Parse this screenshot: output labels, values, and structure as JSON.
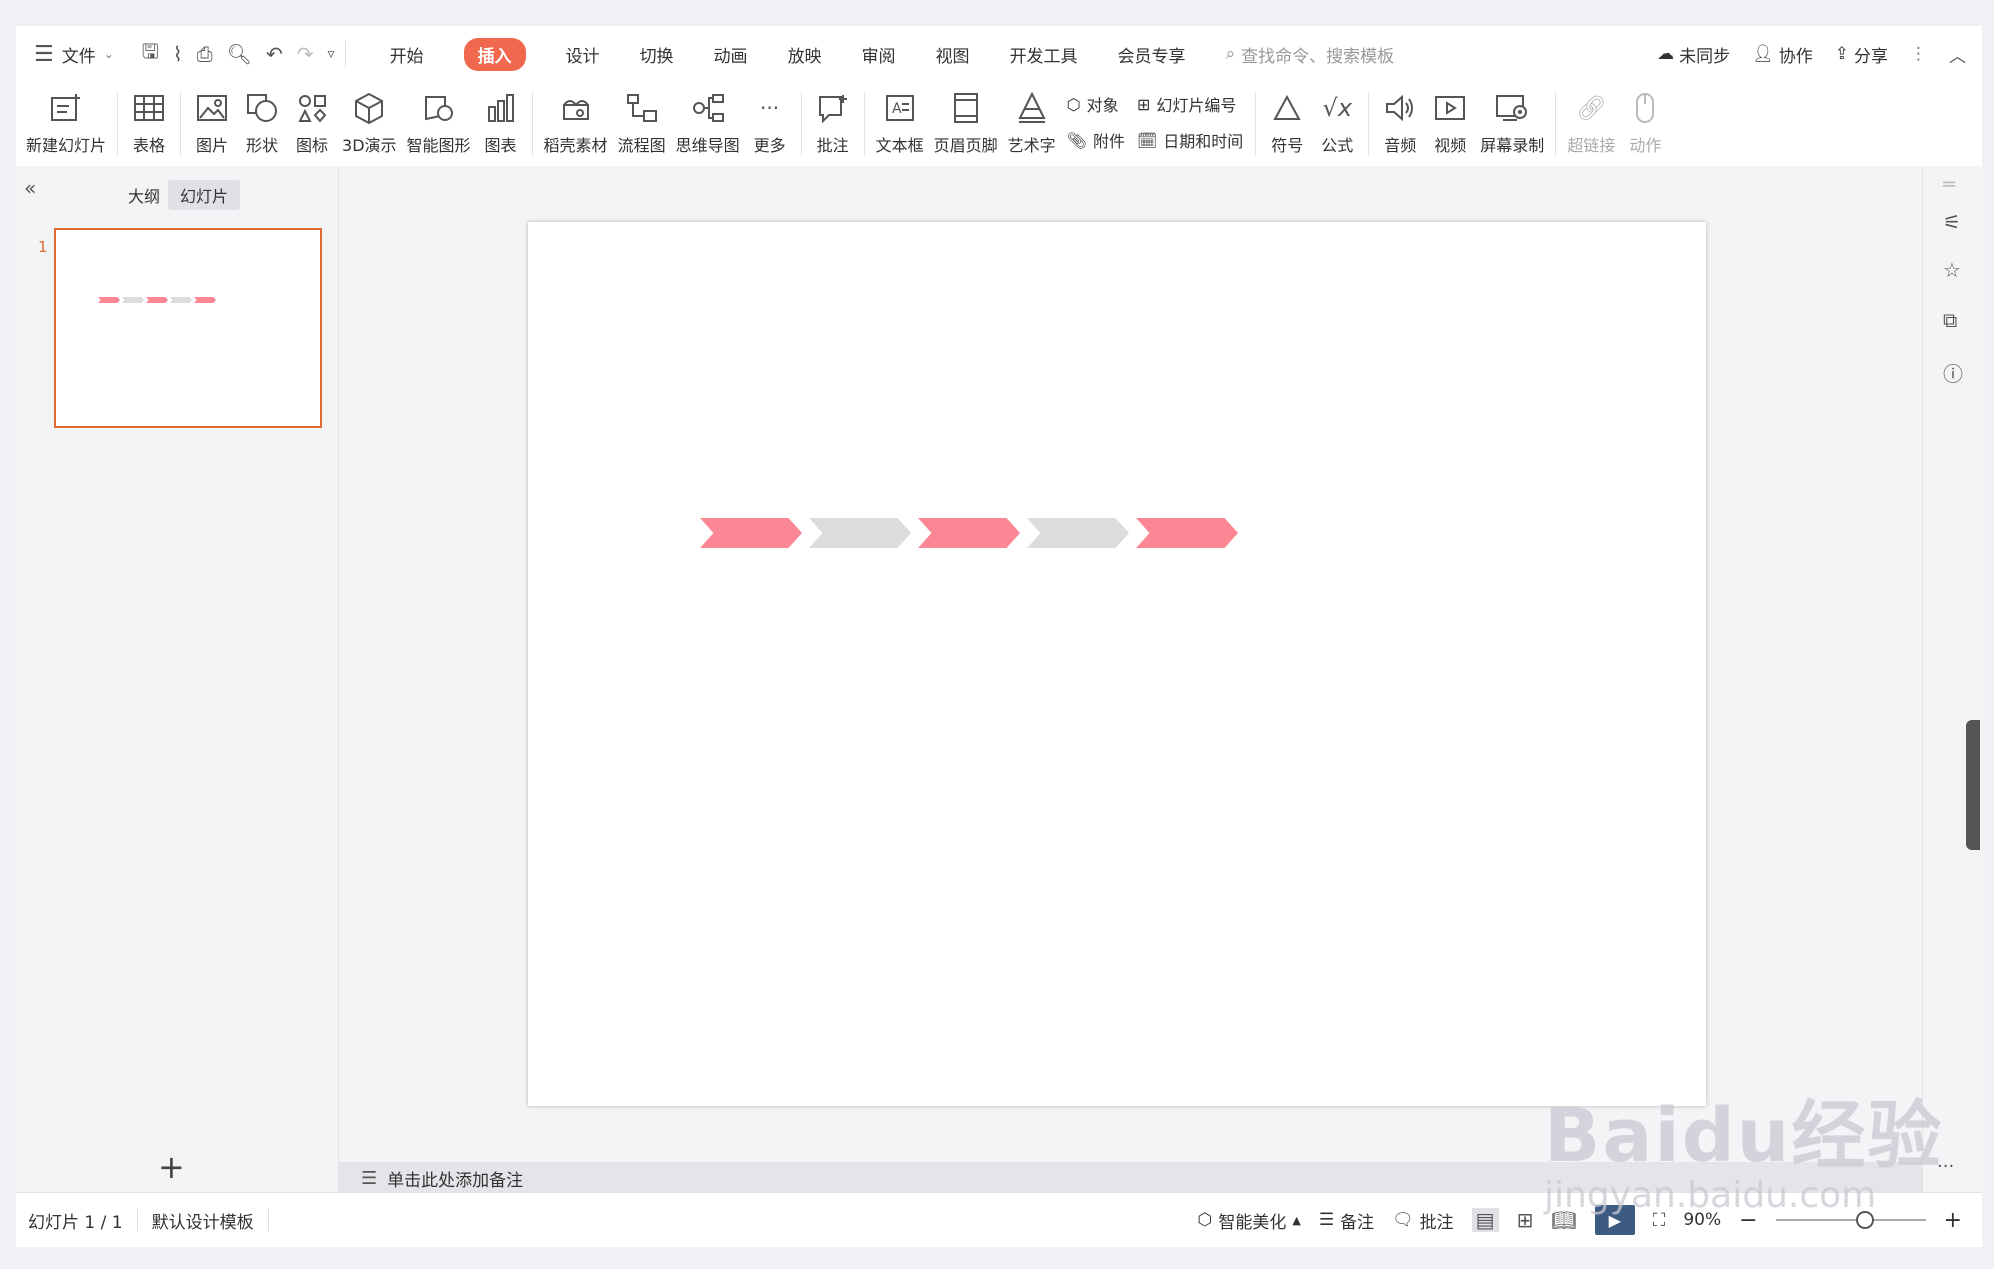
{
  "menu": {
    "file_label": "文件"
  },
  "tabs": [
    "开始",
    "插入",
    "设计",
    "切换",
    "动画",
    "放映",
    "审阅",
    "视图",
    "开发工具",
    "会员专享"
  ],
  "active_tab": "插入",
  "search": {
    "placeholder": "查找命令、搜索模板"
  },
  "top_right": {
    "sync": "未同步",
    "collab": "协作",
    "share": "分享"
  },
  "ribbon": {
    "new_slide": "新建幻灯片",
    "table": "表格",
    "picture": "图片",
    "shape": "形状",
    "icon": "图标",
    "three_d": "3D演示",
    "smart_graphic": "智能图形",
    "chart": "图表",
    "material": "稻壳素材",
    "flowchart": "流程图",
    "mindmap": "思维导图",
    "more": "更多",
    "comment": "批注",
    "textbox": "文本框",
    "header_footer": "页眉页脚",
    "wordart": "艺术字",
    "object": "对象",
    "slide_number": "幻灯片编号",
    "attachment": "附件",
    "datetime": "日期和时间",
    "symbol": "符号",
    "formula": "公式",
    "audio": "音频",
    "video": "视频",
    "screen_record": "屏幕录制",
    "hyperlink": "超链接",
    "action": "动作"
  },
  "left_panel": {
    "outline_tab": "大纲",
    "slides_tab": "幻灯片",
    "slide_number": "1"
  },
  "notes": {
    "placeholder": "单击此处添加备注"
  },
  "status": {
    "slide_info": "幻灯片 1 / 1",
    "template": "默认设计模板",
    "beautify": "智能美化",
    "notes": "备注",
    "comments": "批注",
    "zoom": "90%"
  },
  "slide_content": {
    "chevron_colors": [
      "#fb8794",
      "#dcdcdc",
      "#fb8794",
      "#dcdcdc",
      "#fb8794"
    ]
  },
  "watermark": {
    "line1": "Baidu经验",
    "line2": "jingyan.baidu.com"
  }
}
